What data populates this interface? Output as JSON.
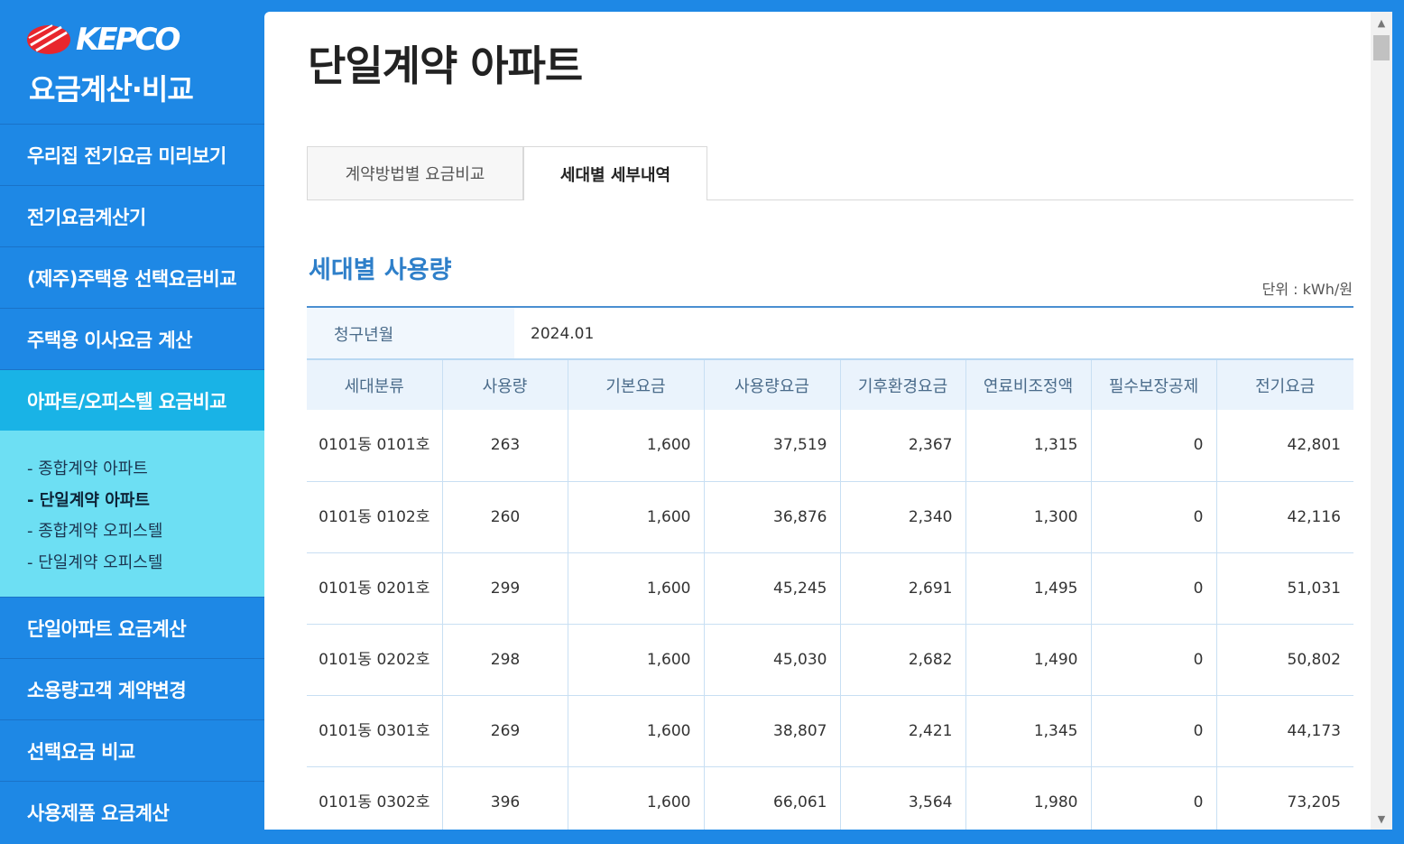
{
  "brand": {
    "logo_text": "KEPCO",
    "title": "요금계산·비교",
    "colors": {
      "primary": "#1e88e5",
      "active": "#19b3e6",
      "submenu_bg": "#6ddff3",
      "logo_red": "#e8262d"
    }
  },
  "sidebar": {
    "items_top": [
      {
        "label": "우리집 전기요금 미리보기"
      },
      {
        "label": "전기요금계산기"
      },
      {
        "label": "(제주)주택용 선택요금비교"
      },
      {
        "label": "주택용 이사요금 계산"
      }
    ],
    "active_item": {
      "label": "아파트/오피스텔 요금비교"
    },
    "submenu": [
      {
        "label": "- 종합계약 아파트"
      },
      {
        "label": "- 단일계약 아파트"
      },
      {
        "label": "- 종합계약 오피스텔"
      },
      {
        "label": "- 단일계약 오피스텔"
      }
    ],
    "items_bottom": [
      {
        "label": "단일아파트 요금계산"
      },
      {
        "label": "소용량고객 계약변경"
      },
      {
        "label": "선택요금 비교"
      },
      {
        "label": "사용제품 요금계산"
      }
    ]
  },
  "main": {
    "title": "단일계약 아파트",
    "tabs": [
      {
        "label": "계약방법별 요금비교"
      },
      {
        "label": "세대별 세부내역"
      }
    ],
    "section_title": "세대별 사용량",
    "unit": "단위 : kWh/원",
    "billing": {
      "label": "청구년월",
      "value": "2024.01"
    },
    "table": {
      "headers": [
        "세대분류",
        "사용량",
        "기본요금",
        "사용량요금",
        "기후환경요금",
        "연료비조정액",
        "필수보장공제",
        "전기요금"
      ],
      "rows": [
        [
          "0101동 0101호",
          "263",
          "1,600",
          "37,519",
          "2,367",
          "1,315",
          "0",
          "42,801"
        ],
        [
          "0101동 0102호",
          "260",
          "1,600",
          "36,876",
          "2,340",
          "1,300",
          "0",
          "42,116"
        ],
        [
          "0101동 0201호",
          "299",
          "1,600",
          "45,245",
          "2,691",
          "1,495",
          "0",
          "51,031"
        ],
        [
          "0101동 0202호",
          "298",
          "1,600",
          "45,030",
          "2,682",
          "1,490",
          "0",
          "50,802"
        ],
        [
          "0101동 0301호",
          "269",
          "1,600",
          "38,807",
          "2,421",
          "1,345",
          "0",
          "44,173"
        ],
        [
          "0101동 0302호",
          "396",
          "1,600",
          "66,061",
          "3,564",
          "1,980",
          "0",
          "73,205"
        ]
      ]
    }
  },
  "scrollbar": {
    "up_icon": "caret-up-icon",
    "down_icon": "caret-down-icon"
  }
}
